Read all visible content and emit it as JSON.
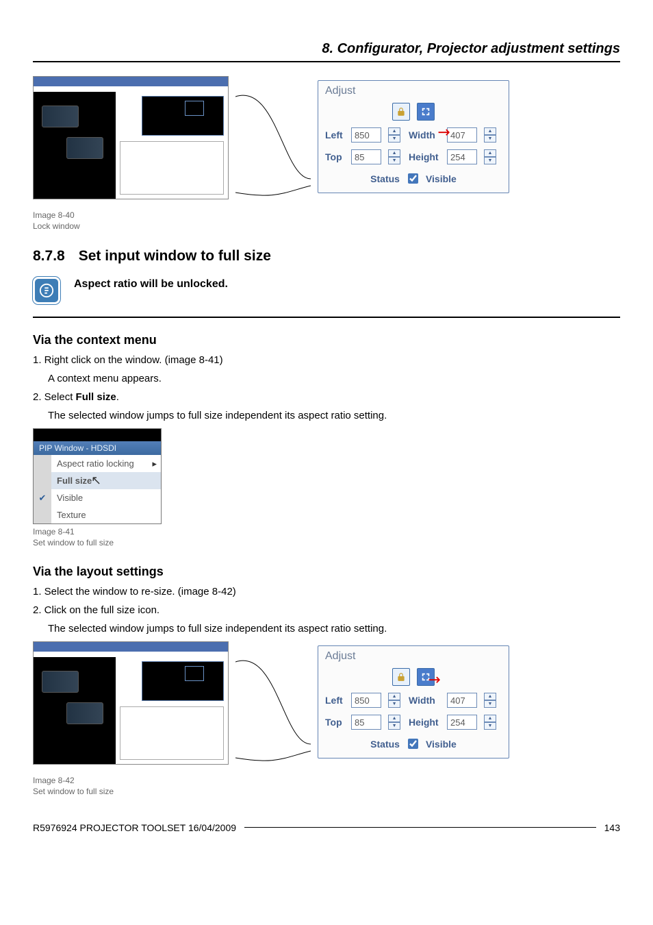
{
  "header": {
    "chapter_title": "8. Configurator, Projector adjustment settings"
  },
  "figure_a": {
    "caption_line1": "Image 8-40",
    "caption_line2": "Lock window",
    "adjust": {
      "title": "Adjust",
      "left_label": "Left",
      "left_value": "850",
      "width_label": "Width",
      "width_value": "407",
      "top_label": "Top",
      "top_value": "85",
      "height_label": "Height",
      "height_value": "254",
      "status_label": "Status",
      "visible_label": "Visible"
    }
  },
  "section": {
    "number": "8.7.8",
    "title": "Set input window to full size"
  },
  "note": {
    "text": "Aspect ratio will be unlocked."
  },
  "ctx": {
    "heading": "Via the context menu",
    "step1": "1. Right click on the window. (image 8-41)",
    "step1_result": "A context menu appears.",
    "step2_pre": "2. Select ",
    "step2_bold": "Full size",
    "step2_post": ".",
    "step2_result": "The selected window jumps to full size independent its aspect ratio setting.",
    "menu": {
      "pip_title": "PIP Window - HDSDI",
      "item_aspect": "Aspect ratio locking",
      "item_full": "Full size",
      "item_visible": "Visible",
      "item_texture": "Texture"
    },
    "caption_line1": "Image 8-41",
    "caption_line2": "Set window to full size"
  },
  "layout": {
    "heading": "Via the layout settings",
    "step1": "1. Select the window to re-size. (image 8-42)",
    "step2": "2. Click on the full size icon.",
    "step2_result": "The selected window jumps to full size independent its aspect ratio setting."
  },
  "figure_b": {
    "caption_line1": "Image 8-42",
    "caption_line2": "Set window to full size",
    "adjust": {
      "title": "Adjust",
      "left_label": "Left",
      "left_value": "850",
      "width_label": "Width",
      "width_value": "407",
      "top_label": "Top",
      "top_value": "85",
      "height_label": "Height",
      "height_value": "254",
      "status_label": "Status",
      "visible_label": "Visible"
    }
  },
  "footer": {
    "doc_id": "R5976924  PROJECTOR TOOLSET  16/04/2009",
    "page": "143"
  }
}
